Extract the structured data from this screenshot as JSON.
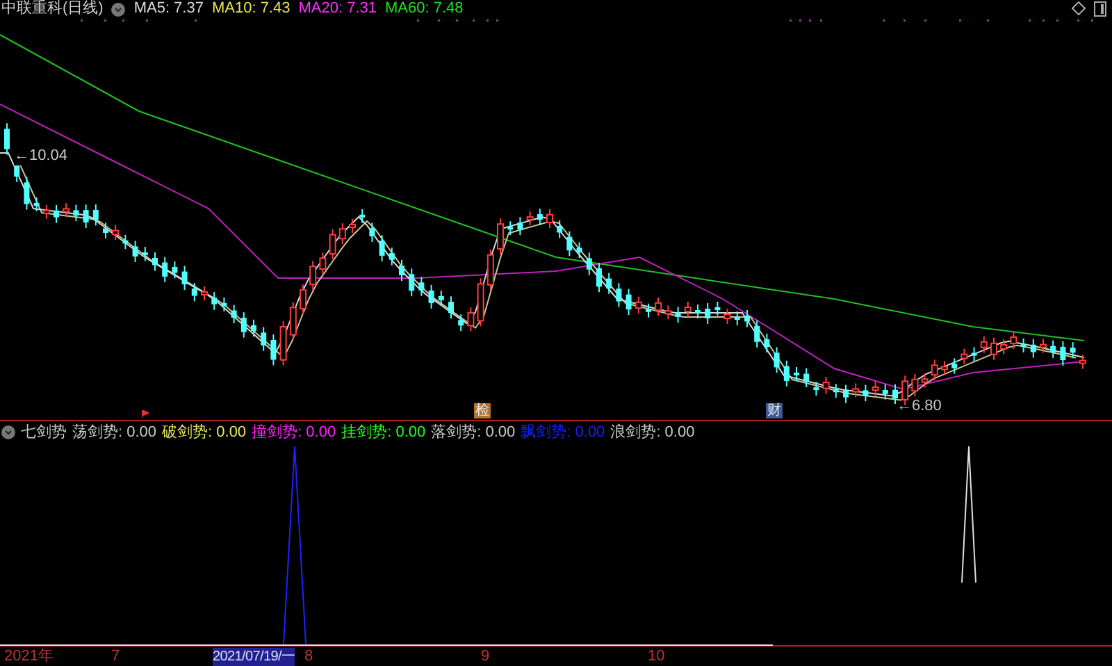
{
  "title": "中联重科(日线)",
  "ma": [
    {
      "label": "MA5: 7.37",
      "color": "#dcdcdc"
    },
    {
      "label": "MA10: 7.43",
      "color": "#e6e650"
    },
    {
      "label": "MA20: 7.31",
      "color": "#ff30ff"
    },
    {
      "label": "MA60: 7.48",
      "color": "#20e020"
    }
  ],
  "price_labels": [
    "←10.04",
    "←6.80"
  ],
  "event_markers": [
    {
      "text": "检",
      "color": "#b07030"
    },
    {
      "text": "财",
      "color": "#3a5a9a"
    }
  ],
  "indicator": {
    "name": "七剑势",
    "values": [
      {
        "label": "荡剑势: 0.00",
        "color": "#c8c8c8"
      },
      {
        "label": "破剑势: 0.00",
        "color": "#e6e660"
      },
      {
        "label": "撞剑势: 0.00",
        "color": "#ff20ff"
      },
      {
        "label": "挂剑势: 0.00",
        "color": "#20ff20"
      },
      {
        "label": "落剑势: 0.00",
        "color": "#c8c8c8"
      },
      {
        "label": "飘剑势: 0.00",
        "color": "#1020ff"
      },
      {
        "label": "浪剑势: 0.00",
        "color": "#c8c8c8"
      }
    ]
  },
  "axis": [
    {
      "label": "2021年",
      "kind": "tick"
    },
    {
      "label": "7",
      "kind": "tick"
    },
    {
      "label": "2021/07/19/一",
      "kind": "cursor"
    },
    {
      "label": "8",
      "kind": "tick"
    },
    {
      "label": "9",
      "kind": "tick"
    },
    {
      "label": "10",
      "kind": "tick"
    }
  ]
}
